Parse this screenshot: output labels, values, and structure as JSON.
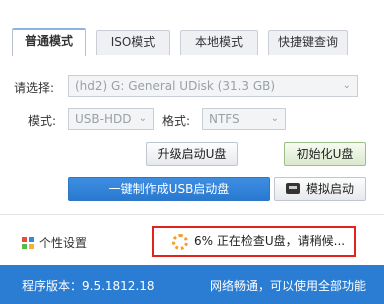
{
  "tabs": [
    {
      "label": "普通模式"
    },
    {
      "label": "ISO模式"
    },
    {
      "label": "本地模式"
    },
    {
      "label": "快捷键查询"
    }
  ],
  "form": {
    "select_label": "请选择:",
    "disk_value": "(hd2) G: General UDisk (31.3 GB)",
    "mode_label": "模式:",
    "mode_value": "USB-HDD",
    "format_label": "格式:",
    "format_value": "NTFS"
  },
  "buttons": {
    "upgrade": "升级启动U盘",
    "init": "初始化U盘",
    "create": "一键制作成USB启动盘",
    "simulate": "模拟启动"
  },
  "personal": {
    "label": "个性设置",
    "icon": "grid-icon"
  },
  "status": {
    "text": "6% 正在检查U盘，请稍候..."
  },
  "footer": {
    "version": "程序版本：9.5.1812.18",
    "network": "网络畅通，可以使用全部功能"
  },
  "colors": {
    "accent": "#2b7cd3",
    "status_border": "#e0241b",
    "create_button": "#2f81d9"
  }
}
